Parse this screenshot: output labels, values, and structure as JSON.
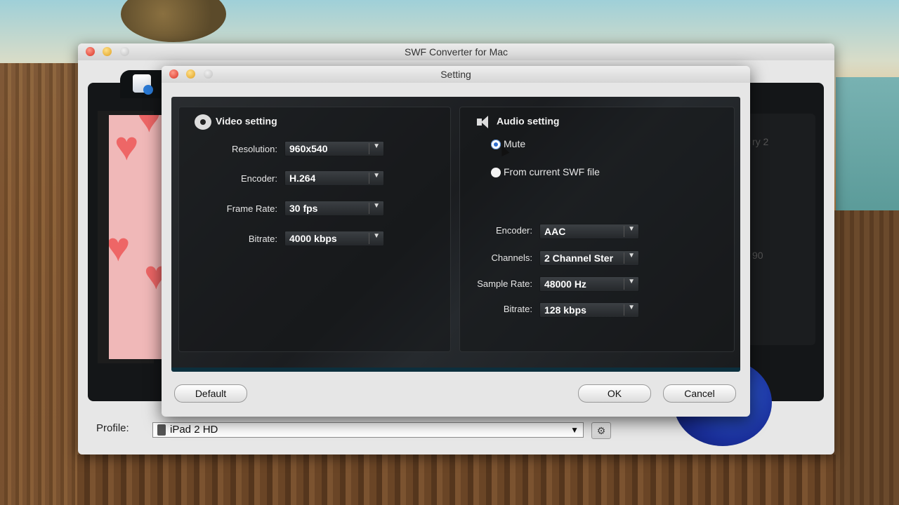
{
  "main_window": {
    "title": "SWF Converter for Mac",
    "ghost_text_1": "ry 2",
    "ghost_text_2": "90",
    "profile": {
      "label": "Profile:",
      "value": "iPad 2 HD",
      "icon": "ipad-icon",
      "settings_icon": "gear-icon"
    }
  },
  "dialog": {
    "title": "Setting",
    "video": {
      "heading": "Video setting",
      "icon": "film-reel-icon",
      "fields": [
        {
          "label": "Resolution:",
          "value": "960x540"
        },
        {
          "label": "Encoder:",
          "value": "H.264"
        },
        {
          "label": "Frame Rate:",
          "value": "30 fps"
        },
        {
          "label": "Bitrate:",
          "value": "4000 kbps"
        }
      ]
    },
    "audio": {
      "heading": "Audio setting",
      "icon": "speaker-icon",
      "radio": {
        "mute": "Mute",
        "from_file": "From current SWF file",
        "selected": "mute"
      },
      "fields": [
        {
          "label": "Encoder:",
          "value": "AAC"
        },
        {
          "label": "Channels:",
          "value": "2 Channel Ster"
        },
        {
          "label": "Sample Rate:",
          "value": "48000 Hz"
        },
        {
          "label": "Bitrate:",
          "value": "128 kbps"
        }
      ]
    },
    "buttons": {
      "default": "Default",
      "ok": "OK",
      "cancel": "Cancel"
    }
  }
}
